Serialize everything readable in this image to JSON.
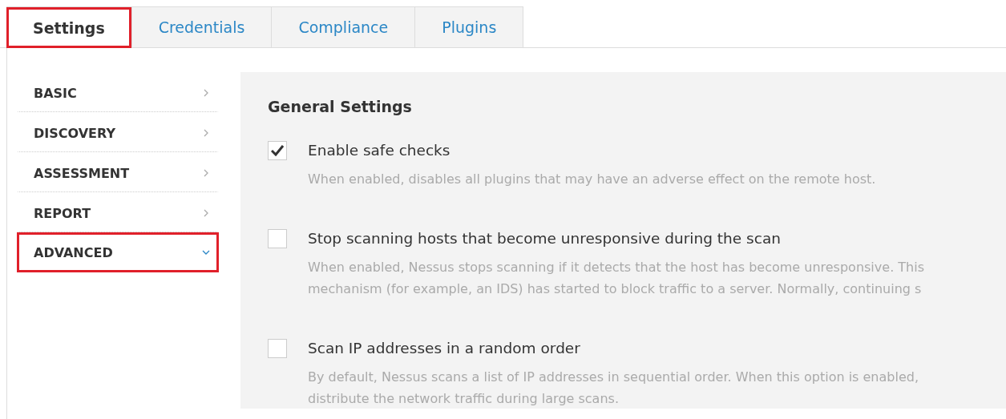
{
  "tabs": [
    {
      "label": "Settings",
      "selected": true,
      "highlighted": true
    },
    {
      "label": "Credentials",
      "selected": false,
      "highlighted": false
    },
    {
      "label": "Compliance",
      "selected": false,
      "highlighted": false
    },
    {
      "label": "Plugins",
      "selected": false,
      "highlighted": false
    }
  ],
  "sidebar": {
    "items": [
      {
        "label": "BASIC",
        "expanded": false,
        "highlighted": false
      },
      {
        "label": "DISCOVERY",
        "expanded": false,
        "highlighted": false
      },
      {
        "label": "ASSESSMENT",
        "expanded": false,
        "highlighted": false
      },
      {
        "label": "REPORT",
        "expanded": false,
        "highlighted": false
      },
      {
        "label": "ADVANCED",
        "expanded": true,
        "highlighted": true
      }
    ]
  },
  "panel": {
    "title": "General Settings",
    "options": [
      {
        "label": "Enable safe checks",
        "checked": true,
        "description": [
          "When enabled, disables all plugins that may have an adverse effect on the remote host."
        ]
      },
      {
        "label": "Stop scanning hosts that become unresponsive during the scan",
        "checked": false,
        "description": [
          "When enabled, Nessus stops scanning if it detects that the host has become unresponsive. This",
          "mechanism (for example, an IDS) has started to block traffic to a server. Normally, continuing s"
        ]
      },
      {
        "label": "Scan IP addresses in a random order",
        "checked": false,
        "description": [
          "By default, Nessus scans a list of IP addresses in sequential order. When this option is enabled,",
          "distribute the network traffic during large scans."
        ]
      }
    ]
  }
}
